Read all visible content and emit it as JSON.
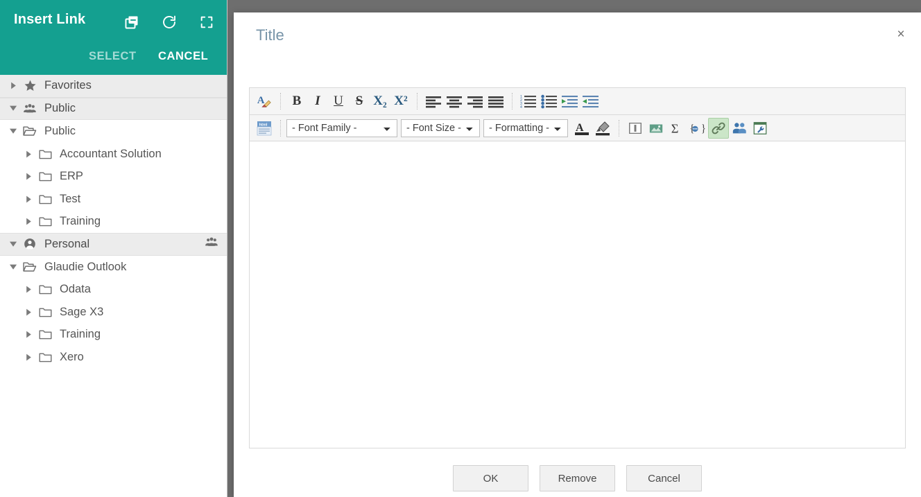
{
  "picker": {
    "title": "Insert Link",
    "header_icons": [
      {
        "name": "copy-icon",
        "label": "Copy"
      },
      {
        "name": "refresh-icon",
        "label": "Refresh"
      },
      {
        "name": "fullscreen-icon",
        "label": "Fullscreen"
      }
    ],
    "select_label": "SELECT",
    "cancel_label": "CANCEL",
    "accent_color": "#14a090",
    "tree": [
      {
        "label": "Favorites",
        "icon": "star-icon",
        "type": "section",
        "depth": 0,
        "expanded": false
      },
      {
        "label": "Public",
        "icon": "group-icon",
        "type": "section",
        "depth": 0,
        "expanded": true
      },
      {
        "label": "Public",
        "icon": "folder-open-icon",
        "type": "folder",
        "depth": 0,
        "expanded": true
      },
      {
        "label": "Accountant Solution",
        "icon": "folder-icon",
        "type": "folder",
        "depth": 1,
        "expanded": false
      },
      {
        "label": "ERP",
        "icon": "folder-icon",
        "type": "folder",
        "depth": 1,
        "expanded": false
      },
      {
        "label": "Test",
        "icon": "folder-icon",
        "type": "folder",
        "depth": 1,
        "expanded": false
      },
      {
        "label": "Training",
        "icon": "folder-icon",
        "type": "folder",
        "depth": 1,
        "expanded": false
      },
      {
        "label": "Personal",
        "icon": "person-icon",
        "type": "section",
        "depth": 0,
        "expanded": true,
        "right_icon": "group-icon"
      },
      {
        "label": "Glaudie Outlook",
        "icon": "folder-open-icon",
        "type": "folder",
        "depth": 0,
        "expanded": true
      },
      {
        "label": "Odata",
        "icon": "folder-icon",
        "type": "folder",
        "depth": 1,
        "expanded": false
      },
      {
        "label": "Sage X3",
        "icon": "folder-icon",
        "type": "folder",
        "depth": 1,
        "expanded": false
      },
      {
        "label": "Training",
        "icon": "folder-icon",
        "type": "folder",
        "depth": 1,
        "expanded": false
      },
      {
        "label": "Xero",
        "icon": "folder-icon",
        "type": "folder",
        "depth": 1,
        "expanded": false
      }
    ]
  },
  "modal": {
    "title": "Title",
    "close_label": "×",
    "editor": {
      "content": "",
      "toolbar_row1": [
        {
          "name": "clear-formatting-icon",
          "kind": "icon",
          "glyph": "A-eraser"
        },
        {
          "name": "bold-button",
          "kind": "text",
          "glyph": "B",
          "style": "bold"
        },
        {
          "name": "italic-button",
          "kind": "text",
          "glyph": "I",
          "style": "ital"
        },
        {
          "name": "underline-button",
          "kind": "text",
          "glyph": "U",
          "style": "undl"
        },
        {
          "name": "strikethrough-button",
          "kind": "text",
          "glyph": "S",
          "style": "strk"
        },
        {
          "name": "subscript-button",
          "kind": "text",
          "glyph": "X₂",
          "style": "sub"
        },
        {
          "name": "superscript-button",
          "kind": "text",
          "glyph": "X²",
          "style": "sup"
        },
        {
          "name": "align-left-button",
          "kind": "lines",
          "align": "left"
        },
        {
          "name": "align-center-button",
          "kind": "lines",
          "align": "center"
        },
        {
          "name": "align-right-button",
          "kind": "lines",
          "align": "right"
        },
        {
          "name": "align-justify-button",
          "kind": "lines",
          "align": "justify"
        },
        {
          "name": "numbered-list-button",
          "kind": "list",
          "variant": "numbered"
        },
        {
          "name": "bulleted-list-button",
          "kind": "list",
          "variant": "bulleted"
        },
        {
          "name": "indent-button",
          "kind": "list",
          "variant": "indent"
        },
        {
          "name": "outdent-button",
          "kind": "list",
          "variant": "outdent"
        }
      ],
      "html_source_label": "html",
      "selects": [
        {
          "name": "font-family-select",
          "value": "- Font Family -"
        },
        {
          "name": "font-size-select",
          "value": "- Font Size -"
        },
        {
          "name": "formatting-select",
          "value": "- Formatting -"
        }
      ],
      "toolbar_row2_icons": [
        {
          "name": "text-color-icon"
        },
        {
          "name": "highlight-color-icon"
        },
        {
          "name": "insert-table-icon"
        },
        {
          "name": "insert-image-icon"
        },
        {
          "name": "insert-formula-icon"
        },
        {
          "name": "insert-placeholder-icon"
        },
        {
          "name": "insert-link-icon",
          "active": true
        },
        {
          "name": "insert-contact-icon"
        },
        {
          "name": "tools-icon"
        }
      ]
    },
    "footer": {
      "ok_label": "OK",
      "remove_label": "Remove",
      "cancel_label": "Cancel"
    }
  }
}
